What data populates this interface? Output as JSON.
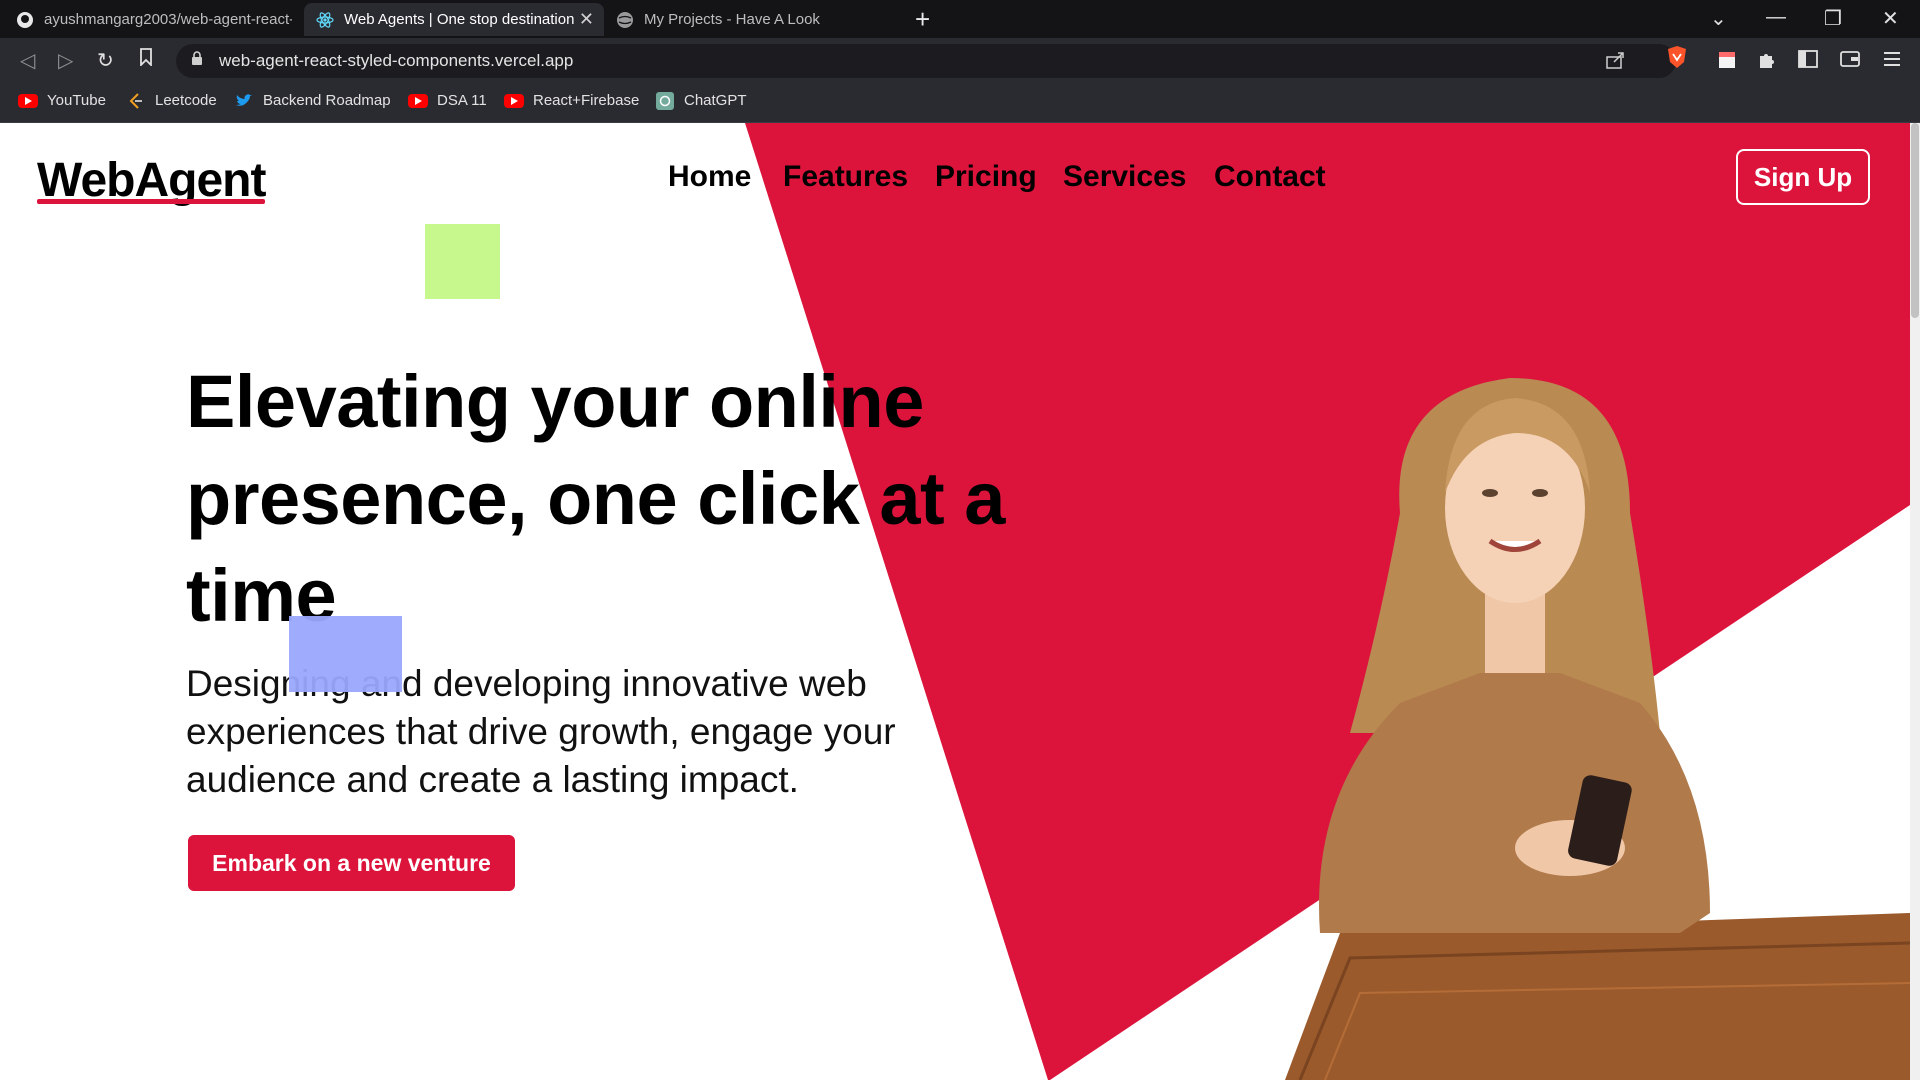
{
  "browser": {
    "tabs": [
      {
        "title": "ayushmangarg2003/web-agent-react-",
        "active": false
      },
      {
        "title": "Web Agents | One stop destination",
        "active": true
      },
      {
        "title": "My Projects - Have A Look",
        "active": false
      }
    ],
    "url": "web-agent-react-styled-components.vercel.app",
    "bookmarks": [
      {
        "label": "YouTube",
        "icon": "youtube-icon"
      },
      {
        "label": "Leetcode",
        "icon": "leetcode-icon"
      },
      {
        "label": "Backend Roadmap",
        "icon": "twitter-icon"
      },
      {
        "label": "DSA 11",
        "icon": "youtube-icon"
      },
      {
        "label": "React+Firebase",
        "icon": "youtube-icon"
      },
      {
        "label": "ChatGPT",
        "icon": "chatgpt-icon"
      }
    ]
  },
  "site": {
    "logo": "WebAgent",
    "nav": [
      "Home",
      "Features",
      "Pricing",
      "Services",
      "Contact"
    ],
    "signup_label": "Sign Up",
    "hero": {
      "headline_line1": "Elevating your online",
      "headline_line2": "presence, one click at a",
      "headline_line3": "time",
      "subtitle": "Designing and developing innovative web experiences that drive growth, engage your audience and create a lasting impact.",
      "cta_label": "Embark on a new venture"
    },
    "colors": {
      "accent": "#dc143c",
      "green_square": "#c7f88d",
      "blue_square": "#9aa6fc"
    }
  }
}
